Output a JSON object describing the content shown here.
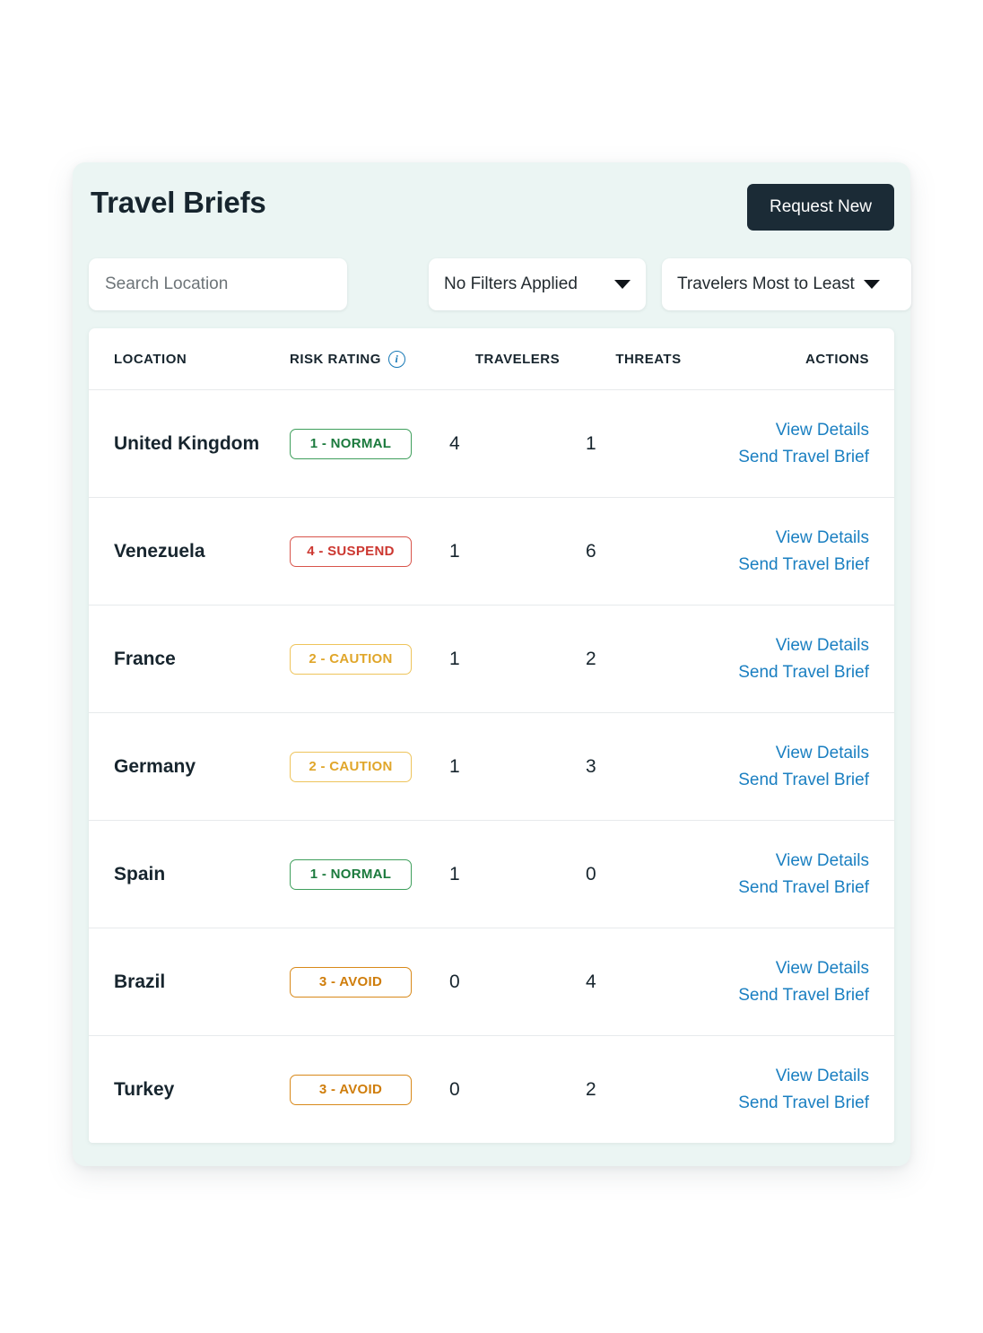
{
  "header": {
    "title": "Travel Briefs",
    "request_new_label": "Request New"
  },
  "controls": {
    "search": {
      "placeholder": "Search Location",
      "value": ""
    },
    "filter_select": {
      "selected": "No Filters Applied",
      "caret_icon": "chevron-down-icon"
    },
    "sort_select": {
      "selected": "Travelers Most to Least",
      "caret_icon": "chevron-down-icon"
    }
  },
  "table": {
    "columns": {
      "location": "LOCATION",
      "risk_rating": "RISK RATING",
      "risk_info_icon": "info-icon",
      "travelers": "TRAVELERS",
      "threats": "THREATS",
      "actions": "ACTIONS"
    },
    "action_labels": {
      "view_details": "View Details",
      "send_travel_brief": "Send Travel Brief"
    },
    "rows": [
      {
        "location": "United Kingdom",
        "risk": "1 - NORMAL",
        "risk_level": "normal",
        "travelers": "4",
        "threats": "1",
        "view_details": "View Details",
        "send_travel_brief": "Send Travel Brief"
      },
      {
        "location": "Venezuela",
        "risk": "4 - SUSPEND",
        "risk_level": "suspend",
        "travelers": "1",
        "threats": "6",
        "view_details": "View Details",
        "send_travel_brief": "Send Travel Brief"
      },
      {
        "location": "France",
        "risk": "2 - CAUTION",
        "risk_level": "caution",
        "travelers": "1",
        "threats": "2",
        "view_details": "View Details",
        "send_travel_brief": "Send Travel Brief"
      },
      {
        "location": "Germany",
        "risk": "2 - CAUTION",
        "risk_level": "caution",
        "travelers": "1",
        "threats": "3",
        "view_details": "View Details",
        "send_travel_brief": "Send Travel Brief"
      },
      {
        "location": "Spain",
        "risk": "1 - NORMAL",
        "risk_level": "normal",
        "travelers": "1",
        "threats": "0",
        "view_details": "View Details",
        "send_travel_brief": "Send Travel Brief"
      },
      {
        "location": "Brazil",
        "risk": "3 - AVOID",
        "risk_level": "avoid",
        "travelers": "0",
        "threats": "4",
        "view_details": "View Details",
        "send_travel_brief": "Send Travel Brief"
      },
      {
        "location": "Turkey",
        "risk": "3 - AVOID",
        "risk_level": "avoid",
        "travelers": "0",
        "threats": "2",
        "view_details": "View Details",
        "send_travel_brief": "Send Travel Brief"
      }
    ]
  },
  "colors": {
    "card_background": "#ebf5f3",
    "page_background": "#ffffff",
    "title_text": "#17252e",
    "primary_button": "#1b2b36",
    "link_blue": "#1a7fc1",
    "info_icon_blue": "#1678b5",
    "risk_normal": "#1b7a3d",
    "risk_caution": "#e0a62a",
    "risk_avoid": "#cf7d0b",
    "risk_suspend": "#cc3730"
  }
}
